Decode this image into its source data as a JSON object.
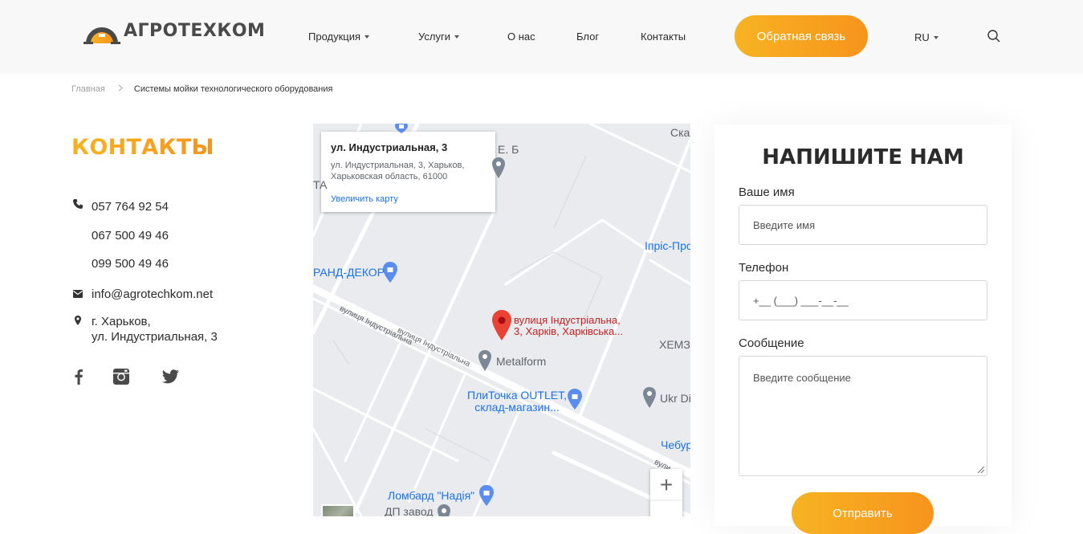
{
  "header": {
    "logo_text": "АГРОТЕХКОМ",
    "nav": [
      {
        "label": "Продукция",
        "has_dropdown": true
      },
      {
        "label": "Услуги",
        "has_dropdown": true
      },
      {
        "label": "О нас",
        "has_dropdown": false
      },
      {
        "label": "Блог",
        "has_dropdown": false
      },
      {
        "label": "Контакты",
        "has_dropdown": false
      }
    ],
    "cta_label": "Обратная связь",
    "language": "RU",
    "search_icon": "search-icon"
  },
  "breadcrumb": {
    "home": "Главная",
    "separator": ">",
    "current": "Системы мойки технологического оборудования"
  },
  "contacts": {
    "title": "КОНТАКТЫ",
    "phones": [
      "057 764 92 54",
      "067 500 49 46",
      "099 500 49 46"
    ],
    "email": "info@agrotechkom.net",
    "address_line1": "г. Харьков,",
    "address_line2": "ул. Индустриальная, 3",
    "social": [
      "facebook-icon",
      "instagram-icon",
      "twitter-icon"
    ]
  },
  "map": {
    "popup_title": "ул. Индустриальная, 3",
    "popup_address_line1": "ул. Индустриальная, 3, Харьков,",
    "popup_address_line2": "Харьковская область, 61000",
    "popup_link": "Увеличить карту",
    "marker_label_line1": "вулиця Індустріальна,",
    "marker_label_line2": "3, Харків, Харківська...",
    "labels": {
      "ska": "Ска",
      "eb": "Е. Б",
      "ta": "ТА",
      "ipris": "Іпріс-Про",
      "grand": "РАНД-ДЕКОР",
      "street1": "вулиця Індустріальна",
      "street2": "вулиця Індустріальна",
      "hemz": "ХЕМЗ",
      "metalform": "Metalform",
      "plitochka1": "ПлиТочка OUTLET,",
      "plitochka2": "склад-магазин...",
      "ukr": "Ukr Di",
      "cheb": "Чебур",
      "vuli": "вули",
      "lombard": "Ломбард \"Надія\"",
      "dp": "ДП завод"
    },
    "zoom_in": "+"
  },
  "form": {
    "title": "НАПИШИТЕ НАМ",
    "name_label": "Ваше имя",
    "name_placeholder": "Введите имя",
    "phone_label": "Телефон",
    "phone_placeholder": "+__ (___) ___-__-__",
    "message_label": "Сообщение",
    "message_placeholder": "Введите сообщение",
    "submit_label": "Отправить"
  },
  "colors": {
    "accent_start": "#f7b322",
    "accent_end": "#f7941d",
    "map_blue": "#1a73e8",
    "marker_red": "#ea4335"
  }
}
